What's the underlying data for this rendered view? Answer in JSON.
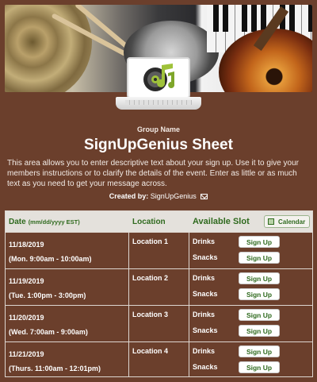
{
  "header": {
    "group_name": "Group Name",
    "title": "SignUpGenius Sheet",
    "description": "This area allows you to enter descriptive text about your sign up. Use it to give your members instructions or to clarify the details of the event. Enter as little or as much text as you need to get your message across.",
    "created_by_label": "Created by:",
    "created_by_name": "SignUpGenius"
  },
  "table": {
    "col_date": "Date",
    "col_date_format": "(mm/dd/yyyy EST)",
    "col_location": "Location",
    "col_slot": "Available Slot",
    "calendar_label": "Calendar",
    "signup_label": "Sign Up",
    "rows": [
      {
        "date": "11/18/2019",
        "time": "(Mon. 9:00am - 10:00am)",
        "location": "Location 1",
        "slots": [
          "Drinks",
          "Snacks"
        ]
      },
      {
        "date": "11/19/2019",
        "time": "(Tue. 1:00pm - 3:00pm)",
        "location": "Location 2",
        "slots": [
          "Drinks",
          "Snacks"
        ]
      },
      {
        "date": "11/20/2019",
        "time": "(Wed. 7:00am - 9:00am)",
        "location": "Location 3",
        "slots": [
          "Drinks",
          "Snacks"
        ]
      },
      {
        "date": "11/21/2019",
        "time": "(Thurs. 11:00am - 12:01pm)",
        "location": "Location 4",
        "slots": [
          "Drinks",
          "Snacks"
        ]
      }
    ]
  },
  "colors": {
    "background": "#6b3f2c",
    "header_green": "#2f6a1e",
    "table_header_bg": "#e4e1dc"
  },
  "icons": [
    "music-speaker-icon",
    "mail-icon",
    "calendar-icon"
  ]
}
